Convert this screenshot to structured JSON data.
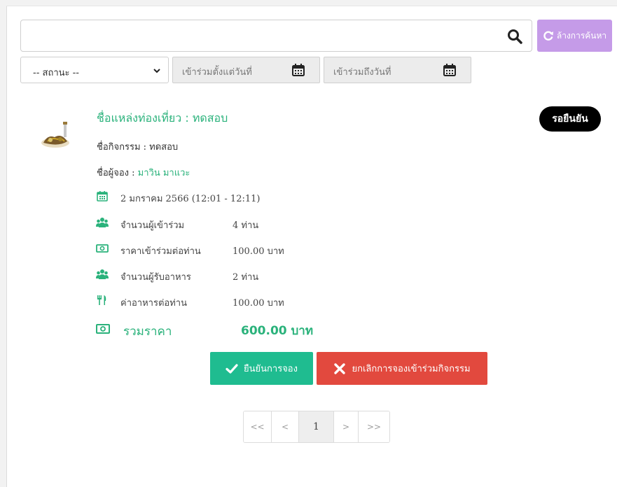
{
  "search": {
    "value": "",
    "placeholder": ""
  },
  "clear_button": {
    "label": "ล้างการค้นหา"
  },
  "filters": {
    "status": {
      "selected": "-- สถานะ --"
    },
    "date_from": {
      "placeholder": "เข้าร่วมตั้งแต่วันที่"
    },
    "date_to": {
      "placeholder": "เข้าร่วมถึงวันที่"
    }
  },
  "booking": {
    "place_title": "ชื่อแหล่งท่องเที่ยว : ทดสอบ",
    "status_badge": "รอยืนยัน",
    "activity_line": "ชื่อกิจกรรม : ทดสอบ",
    "booker_prefix": "ชื่อผู้จอง : ",
    "booker_name": "มาวิน มาแวะ",
    "date_text": "2 มกราคม 2566 (12:01 - 12:11)",
    "details": [
      {
        "icon": "users-icon",
        "label": "จำนวนผู้เข้าร่วม",
        "value": "4 ท่าน"
      },
      {
        "icon": "money-icon",
        "label": "ราคาเข้าร่วมต่อท่าน",
        "value": "100.00 บาท"
      },
      {
        "icon": "users-icon",
        "label": "จำนวนผู้รับอาหาร",
        "value": "2 ท่าน"
      },
      {
        "icon": "utensils-icon",
        "label": "ค่าอาหารต่อท่าน",
        "value": "100.00 บาท"
      }
    ],
    "total_label": "รวมราคา",
    "total_value": "600.00 บาท",
    "confirm_label": "ยืนยันการจอง",
    "cancel_label": "ยกเลิกการจองเข้าร่วมกิจกรรม"
  },
  "pagination": {
    "first": "<<",
    "prev": "<",
    "current": "1",
    "next": ">",
    "last": ">>"
  },
  "colors": {
    "accent_green": "#2ab27b",
    "confirm_green": "#1fbc90",
    "cancel_red": "#e2493e",
    "clear_purple": "#c59be8",
    "badge_black": "#000000"
  }
}
